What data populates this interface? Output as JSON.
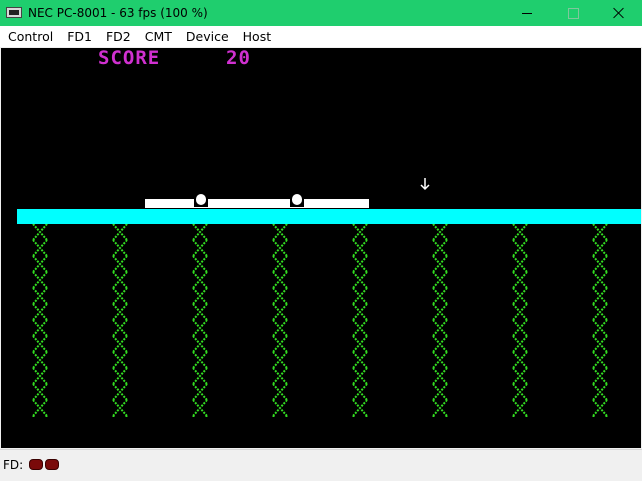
{
  "window": {
    "title": "NEC PC-8001 - 63 fps (100 %)"
  },
  "menu": {
    "items": [
      "Control",
      "FD1",
      "FD2",
      "CMT",
      "Device",
      "Host"
    ]
  },
  "game": {
    "score_label": "SCORE",
    "score_value": "20",
    "colors": {
      "score": "#d030d0",
      "floor": "#00ffff",
      "chain": "#33dd22",
      "platform": "#ffffff",
      "background": "#000000"
    },
    "chain_count": 8
  },
  "status": {
    "fd_label": "FD:",
    "drive_leds": [
      "fd1-led",
      "fd2-led"
    ],
    "led_color": "#7a0a0a"
  }
}
